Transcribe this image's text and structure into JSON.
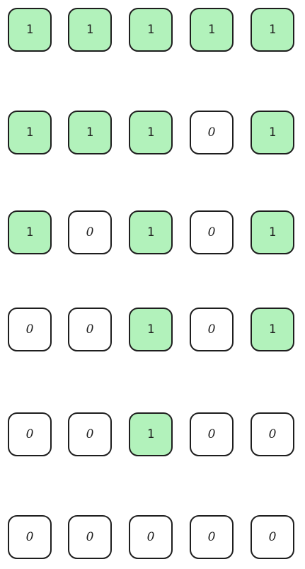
{
  "colors": {
    "on": "#b2f2bb",
    "off": "#ffffff",
    "stroke": "#1e1e1e"
  },
  "grid": [
    [
      "1",
      "1",
      "1",
      "1",
      "1"
    ],
    [
      "1",
      "1",
      "1",
      "0",
      "1"
    ],
    [
      "1",
      "0",
      "1",
      "0",
      "1"
    ],
    [
      "0",
      "0",
      "1",
      "0",
      "1"
    ],
    [
      "0",
      "0",
      "1",
      "0",
      "0"
    ],
    [
      "0",
      "0",
      "0",
      "0",
      "0"
    ]
  ]
}
